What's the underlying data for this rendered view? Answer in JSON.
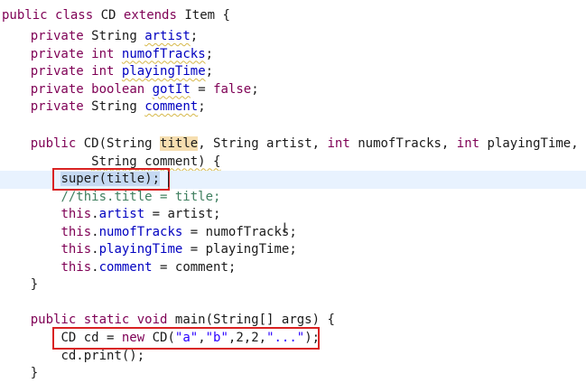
{
  "code": {
    "class_decl": {
      "kw1": "public",
      "kw2": "class",
      "name": "CD",
      "kw3": "extends",
      "parent": "Item",
      "brace": "{"
    },
    "fields": [
      {
        "kw": "private",
        "type": "String",
        "name": "artist",
        "rest": ";"
      },
      {
        "kw": "private",
        "type": "int",
        "name": "numofTracks",
        "rest": ";"
      },
      {
        "kw": "private",
        "type": "int",
        "name": "playingTime",
        "rest": ";"
      },
      {
        "kw": "private",
        "type": "boolean",
        "name": "gotIt",
        "eq": " = ",
        "val": "false",
        "rest": ";"
      },
      {
        "kw": "private",
        "type": "String",
        "name": "comment",
        "rest": ";"
      }
    ],
    "ctor": {
      "kw": "public",
      "sig_a": "CD(String ",
      "p_title": "title",
      "sig_b": ", String artist, ",
      "int1": "int",
      "sig_c": " numofTracks, ",
      "int2": "int",
      "sig_d": " playingTime,",
      "sig_e": "String comment) {",
      "super_call": "super(title);",
      "comment_line": "//this.title = title;",
      "this_kw": "this",
      "assign_artist": {
        "field": "artist",
        "rest": " = artist;"
      },
      "assign_tracks": {
        "field": "numofTracks",
        "rest": " = numofTracks;"
      },
      "assign_time": {
        "field": "playingTime",
        "rest": " = playingTime;"
      },
      "assign_comment": {
        "field": "comment",
        "rest": " = comment;"
      },
      "close": "}"
    },
    "main": {
      "kw1": "public",
      "kw2": "static",
      "kw3": "void",
      "sig": " main(String[] args) {",
      "decl_a": "CD cd = ",
      "new_kw": "new",
      "decl_b": " CD(",
      "s1": "\"a\"",
      "comma1": ",",
      "s2": "\"b\"",
      "nums": ",2,2,",
      "s3": "\"...\"",
      "end": ");",
      "print": "cd.print();",
      "close": "}"
    }
  }
}
